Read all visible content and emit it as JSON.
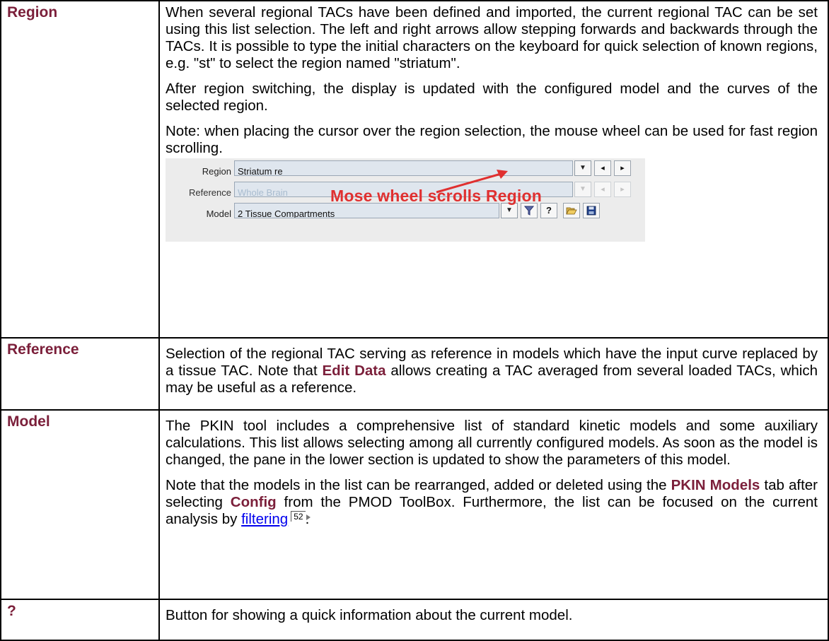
{
  "rows": [
    {
      "term": "Region",
      "paragraphs": [
        "When several regional TACs have been defined and imported, the current regional TAC can be set using this list selection. The left and right arrows allow stepping forwards and backwards through the TACs. It is possible to type the initial characters on the keyboard for quick selection of known regions, e.g. \"st\" to select the region named \"striatum\".",
        "After region switching, the display is updated with the configured model and the curves of the selected region.",
        "Note: when placing the cursor over the region selection, the mouse wheel can be used for fast region scrolling."
      ]
    },
    {
      "term": "Reference",
      "text_before": "Selection of the regional TAC serving as reference in models which have the input curve replaced by a tissue TAC. Note that ",
      "keyword": "Edit Data",
      "text_after": " allows creating a TAC averaged from several loaded TACs, which may be useful as a reference."
    },
    {
      "term": "Model",
      "paragraph1": "The PKIN tool includes a comprehensive list of standard kinetic models and some auxiliary calculations. This list allows selecting among all currently configured models. As soon as the model is changed, the pane in the lower section is updated to show the parameters of this model.",
      "p2_a": "Note that the models in the list can be rearranged, added or deleted using the ",
      "p2_kw1": "PKIN Models",
      "p2_b": " tab after selecting ",
      "p2_kw2": "Config",
      "p2_c": " from the PMOD ToolBox. Furthermore, the list can be focused on the current analysis by ",
      "p2_link": "filtering",
      "p2_pageref": "52",
      "p2_d": "."
    },
    {
      "term": "?",
      "text": "Button for showing a quick information about the current model."
    }
  ],
  "panel": {
    "region_label": "Region",
    "region_value": "Striatum re",
    "reference_label": "Reference",
    "reference_value": "Whole Brain",
    "model_label": "Model",
    "model_value": "2 Tissue Compartments",
    "overlay_text": "Mose wheel scrolls Region",
    "question_label": "?",
    "dropdown_glyph": "▼",
    "prev_glyph": "◂",
    "next_glyph": "▸",
    "filter_icon": "filter-icon",
    "open_icon": "folder-open-icon",
    "save_icon": "save-icon",
    "accent_color": "#7b1f3a",
    "overlay_color": "#e03030"
  }
}
